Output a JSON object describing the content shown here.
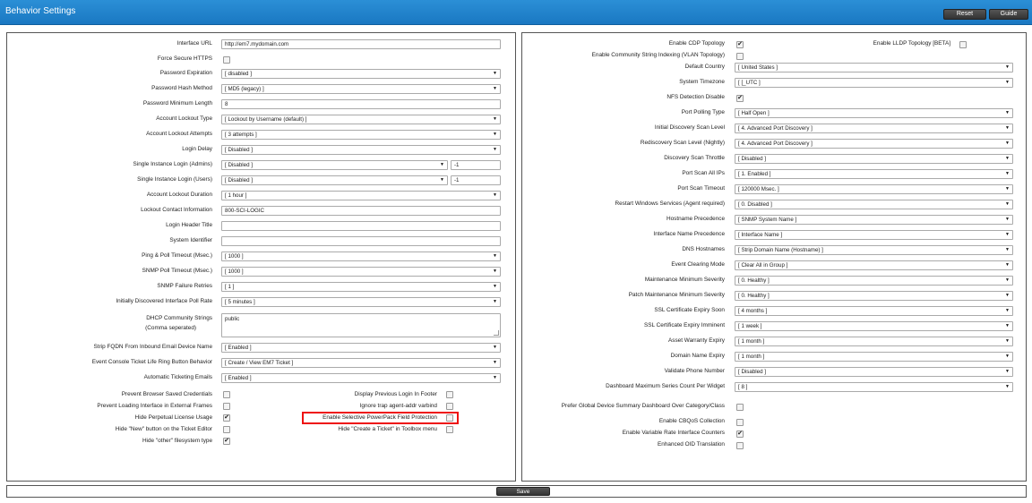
{
  "header": {
    "title": "Behavior Settings",
    "reset_label": "Reset",
    "guide_label": "Guide",
    "save_label": "Save"
  },
  "left": {
    "fields": [
      {
        "label": "Interface URL",
        "type": "text",
        "value": "http://em7.mydomain.com"
      },
      {
        "label": "Force Secure HTTPS",
        "type": "checkbox",
        "checked": false
      },
      {
        "label": "Password Expiration",
        "type": "select",
        "value": "[ disabled ]"
      },
      {
        "label": "Password Hash Method",
        "type": "select",
        "value": "[ MD5 (legacy) ]"
      },
      {
        "label": "Password Minimum Length",
        "type": "text",
        "value": "8"
      },
      {
        "label": "Account Lockout Type",
        "type": "select",
        "value": "[ Lockout by Username (default) ]"
      },
      {
        "label": "Account Lockout Attempts",
        "type": "select",
        "value": "[ 3 attempts ]"
      },
      {
        "label": "Login Delay",
        "type": "select",
        "value": "[ Disabled ]"
      },
      {
        "label": "Single Instance Login (Admins)",
        "type": "select-small",
        "value": "[ Disabled ]",
        "extra": "-1"
      },
      {
        "label": "Single Instance Login (Users)",
        "type": "select-small",
        "value": "[ Disabled ]",
        "extra": "-1"
      },
      {
        "label": "Account Lockout Duration",
        "type": "select",
        "value": "[ 1 hour ]"
      },
      {
        "label": "Lockout Contact Information",
        "type": "text",
        "value": "800-SCI-LOGIC"
      },
      {
        "label": "Login Header Title",
        "type": "text",
        "value": ""
      },
      {
        "label": "System Identifier",
        "type": "text",
        "value": ""
      },
      {
        "label": "Ping & Poll Timeout (Msec.)",
        "type": "select",
        "value": "[ 1000 ]"
      },
      {
        "label": "SNMP Poll Timeout (Msec.)",
        "type": "select",
        "value": "[ 1000 ]"
      },
      {
        "label": "SNMP Failure Retries",
        "type": "select",
        "value": "[ 1 ]"
      },
      {
        "label": "Initially Discovered Interface Poll Rate",
        "type": "select",
        "value": "[ 5 minutes ]"
      },
      {
        "label": "DHCP Community Strings",
        "label2": "(Comma seperated)",
        "type": "textarea",
        "value": "public"
      },
      {
        "label": "Strip FQDN From Inbound Email Device Name",
        "type": "select",
        "value": "[ Enabled ]"
      },
      {
        "label": "Event Console Ticket Life Ring Button Behavior",
        "type": "select",
        "value": "[ Create / View EM7 Ticket ]"
      },
      {
        "label": "Automatic Ticketing Emails",
        "type": "select",
        "value": "[ Enabled ]"
      }
    ],
    "checkboxes_col1": [
      {
        "label": "Prevent Browser Saved Credentials",
        "checked": false
      },
      {
        "label": "Prevent Loading Interface in External Frames",
        "checked": false
      },
      {
        "label": "Hide Perpetual License Usage",
        "checked": true
      },
      {
        "label": "Hide \"New\" button on the Ticket Editor",
        "checked": false
      },
      {
        "label": "Hide \"other\" filesystem type",
        "checked": true
      }
    ],
    "checkboxes_col2": [
      {
        "label": "Display Previous Login In Footer",
        "checked": false
      },
      {
        "label": "Ignore trap agent-addr varbind",
        "checked": false
      },
      {
        "label": "Enable Selective PowerPack Field Protection",
        "checked": false
      },
      {
        "label": "Hide \"Create a Ticket\" in Toolbox menu",
        "checked": false
      }
    ]
  },
  "right": {
    "cdp": {
      "label": "Enable CDP Topology",
      "checked": true
    },
    "lldp": {
      "label": "Enable LLDP Topology [BETA]",
      "checked": false
    },
    "fields": [
      {
        "label": "Enable Community String Indexing (VLAN Topology)",
        "type": "checkbox",
        "checked": false
      },
      {
        "label": "Default Country",
        "type": "select",
        "value": "[ United States ]"
      },
      {
        "label": "System Timezone",
        "type": "select",
        "value": "[ [_UTC ]"
      },
      {
        "label": "NFS Detection Disable",
        "type": "checkbox",
        "checked": true
      },
      {
        "label": "Port Polling Type",
        "type": "select",
        "value": "[ Half Open ]"
      },
      {
        "label": "Initial Discovery Scan Level",
        "type": "select",
        "value": "[ 4. Advanced Port Discovery ]"
      },
      {
        "label": "Rediscovery Scan Level (Nightly)",
        "type": "select",
        "value": "[ 4. Advanced Port Discovery ]"
      },
      {
        "label": "Discovery Scan Throttle",
        "type": "select",
        "value": "[ Disabled ]"
      },
      {
        "label": "Port Scan All IPs",
        "type": "select",
        "value": "[ 1. Enabled ]"
      },
      {
        "label": "Port Scan Timeout",
        "type": "select",
        "value": "[ 120000 Msec. ]"
      },
      {
        "label": "Restart Windows Services (Agent required)",
        "type": "select",
        "value": "[ 0. Disabled ]"
      },
      {
        "label": "Hostname Precedence",
        "type": "select",
        "value": "[ SNMP System Name ]"
      },
      {
        "label": "Interface Name Precedence",
        "type": "select",
        "value": "[ Interface Name ]"
      },
      {
        "label": "DNS Hostnames",
        "type": "select",
        "value": "[ Strip Domain Name (Hostname) ]"
      },
      {
        "label": "Event Clearing Mode",
        "type": "select",
        "value": "[ Clear All in Group ]"
      },
      {
        "label": "Maintenance Minimum Severity",
        "type": "select",
        "value": "[ 0. Healthy ]"
      },
      {
        "label": "Patch Maintenance Minimum Severity",
        "type": "select",
        "value": "[ 0. Healthy ]"
      },
      {
        "label": "SSL Certificate Expiry Soon",
        "type": "select",
        "value": "[ 4 months ]"
      },
      {
        "label": "SSL Certificate Expiry Imminent",
        "type": "select",
        "value": "[ 1 week ]"
      },
      {
        "label": "Asset Warranty Expiry",
        "type": "select",
        "value": "[ 1 month ]"
      },
      {
        "label": "Domain Name Expiry",
        "type": "select",
        "value": "[ 1 month ]"
      },
      {
        "label": "Validate Phone Number",
        "type": "select",
        "value": "[ Disabled ]"
      },
      {
        "label": "Dashboard Maximum Series Count Per Widget",
        "type": "select",
        "value": "[ 8 ]"
      },
      {
        "label": "Prefer Global Device Summary Dashboard Over Category/Class",
        "type": "checkbox",
        "checked": false
      },
      {
        "label": "Enable CBQoS Collection",
        "type": "checkbox",
        "checked": false
      },
      {
        "label": "Enable Variable Rate Interface Counters",
        "type": "checkbox",
        "checked": true
      },
      {
        "label": "Enhanced OID Translation",
        "type": "checkbox",
        "checked": false
      }
    ]
  }
}
